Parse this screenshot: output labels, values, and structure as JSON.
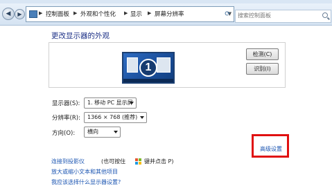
{
  "window": {
    "breadcrumb": [
      {
        "label": "控制面板"
      },
      {
        "label": "外观和个性化"
      },
      {
        "label": "显示"
      },
      {
        "label": "屏幕分辨率"
      }
    ],
    "separator": "▶",
    "search_placeholder": "搜索控制面板"
  },
  "page": {
    "title": "更改显示器的外观",
    "monitor_number": "1",
    "detect_button": "检测(C)",
    "identify_button": "识别(I)"
  },
  "form": {
    "display_label": "显示器(S):",
    "display_value": "1. 移动 PC 显示屏",
    "resolution_label": "分辨率(R):",
    "resolution_value": "1366 × 768 (推荐)",
    "orientation_label": "方向(O):",
    "orientation_value": "横向"
  },
  "advanced_settings": "高级设置",
  "links": {
    "projector": "连接到投影仪",
    "projector_hint_1": "(也可按住",
    "projector_hint_2": "键并点击 P)",
    "text_size": "放大或缩小文本和其他项目",
    "other": "我应该选择什么显示器设置?"
  },
  "colors": {
    "link": "#1b55b2",
    "title": "#1e3287",
    "highlight_box": "#e01010"
  }
}
